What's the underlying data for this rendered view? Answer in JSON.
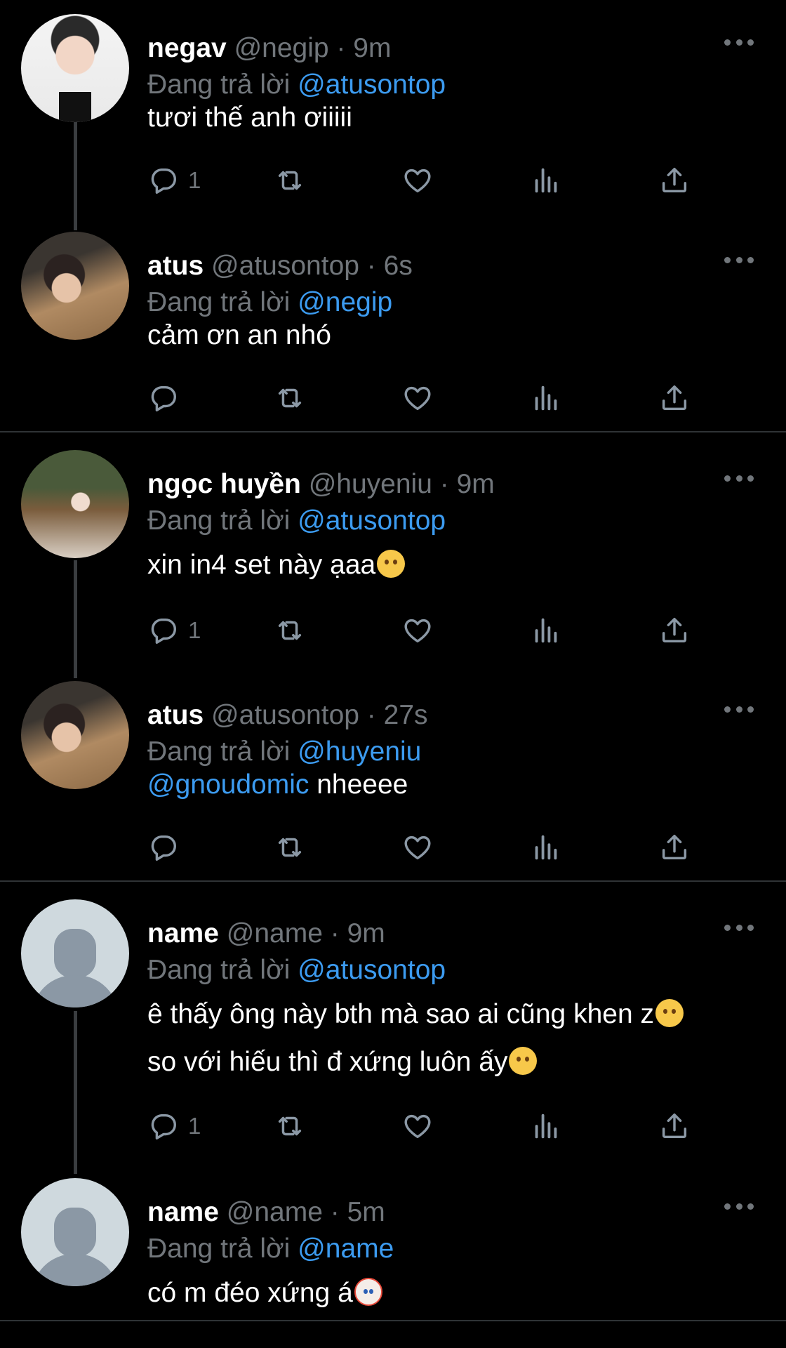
{
  "tweets": [
    {
      "name": "negav",
      "handle": "@negip",
      "time": "9m",
      "reply_prefix": "Đang trả lời",
      "reply_to": "@atusontop",
      "lines": [
        "tươi thế anh ơiiiii"
      ],
      "reply_count": "1"
    },
    {
      "name": "atus",
      "handle": "@atusontop",
      "time": "6s",
      "reply_prefix": "Đang trả lời",
      "reply_to": "@negip",
      "lines": [
        "cảm ơn an nhó"
      ],
      "reply_count": ""
    },
    {
      "name": "ngọc huyền",
      "handle": "@huyeniu",
      "time": "9m",
      "reply_prefix": "Đang trả lời",
      "reply_to": "@atusontop",
      "lines": [
        "xin in4 set này ạaa"
      ],
      "reply_count": "1"
    },
    {
      "name": "atus",
      "handle": "@atusontop",
      "time": "27s",
      "reply_prefix": "Đang trả lời",
      "reply_to": "@huyeniu",
      "mention": "@gnoudomic",
      "lines": [
        "nheeee"
      ],
      "reply_count": ""
    },
    {
      "name": "name",
      "handle": "@name",
      "time": "9m",
      "reply_prefix": "Đang trả lời",
      "reply_to": "@atusontop",
      "lines": [
        "ê thấy ông này bth mà sao ai cũng khen z",
        "so với hiếu thì đ xứng luôn ấy"
      ],
      "reply_count": "1"
    },
    {
      "name": "name",
      "handle": "@name",
      "time": "5m",
      "reply_prefix": "Đang trả lời",
      "reply_to": "@name",
      "lines": [
        "có m đéo xứng á"
      ],
      "reply_count": ""
    }
  ],
  "separator": "·",
  "icons": {
    "reply": "reply-icon",
    "retweet": "retweet-icon",
    "like": "heart-icon",
    "views": "views-icon",
    "share": "share-icon",
    "more": "more-icon"
  },
  "colors": {
    "background": "#000000",
    "text": "#ffffff",
    "muted": "#71767b",
    "link": "#3c9bf0",
    "divider": "#2f3336"
  }
}
